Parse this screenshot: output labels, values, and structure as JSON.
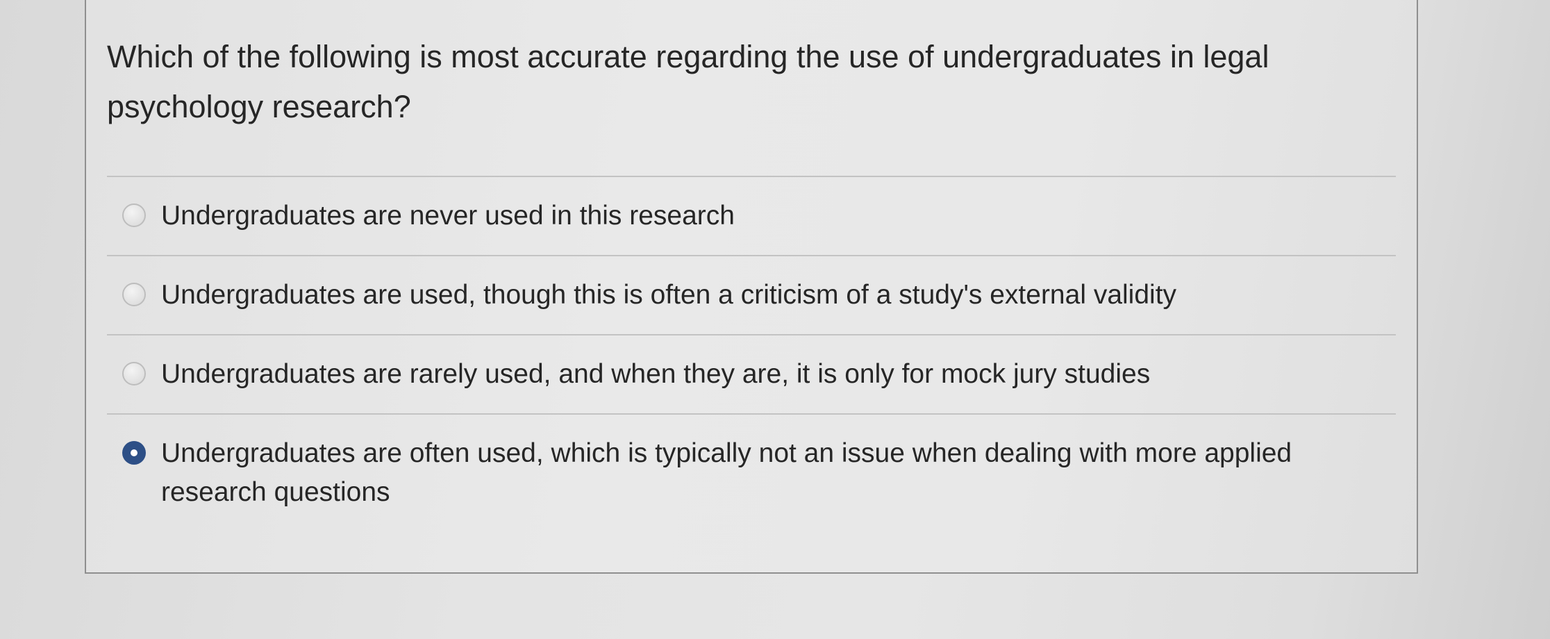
{
  "question": {
    "text": "Which of the following is most accurate regarding the use of undergraduates in legal psychology research?"
  },
  "options": [
    {
      "label": "Undergraduates are never used in this research",
      "selected": false
    },
    {
      "label": "Undergraduates are used, though this is often a criticism of a study's external validity",
      "selected": false
    },
    {
      "label": "Undergraduates are rarely used, and when they are, it is only for mock jury studies",
      "selected": false
    },
    {
      "label": "Undergraduates are often used, which is typically not an issue when dealing with more applied research questions",
      "selected": true
    }
  ],
  "colors": {
    "selected_radio": "#2d4f86",
    "card_border": "#8f8f8f"
  }
}
